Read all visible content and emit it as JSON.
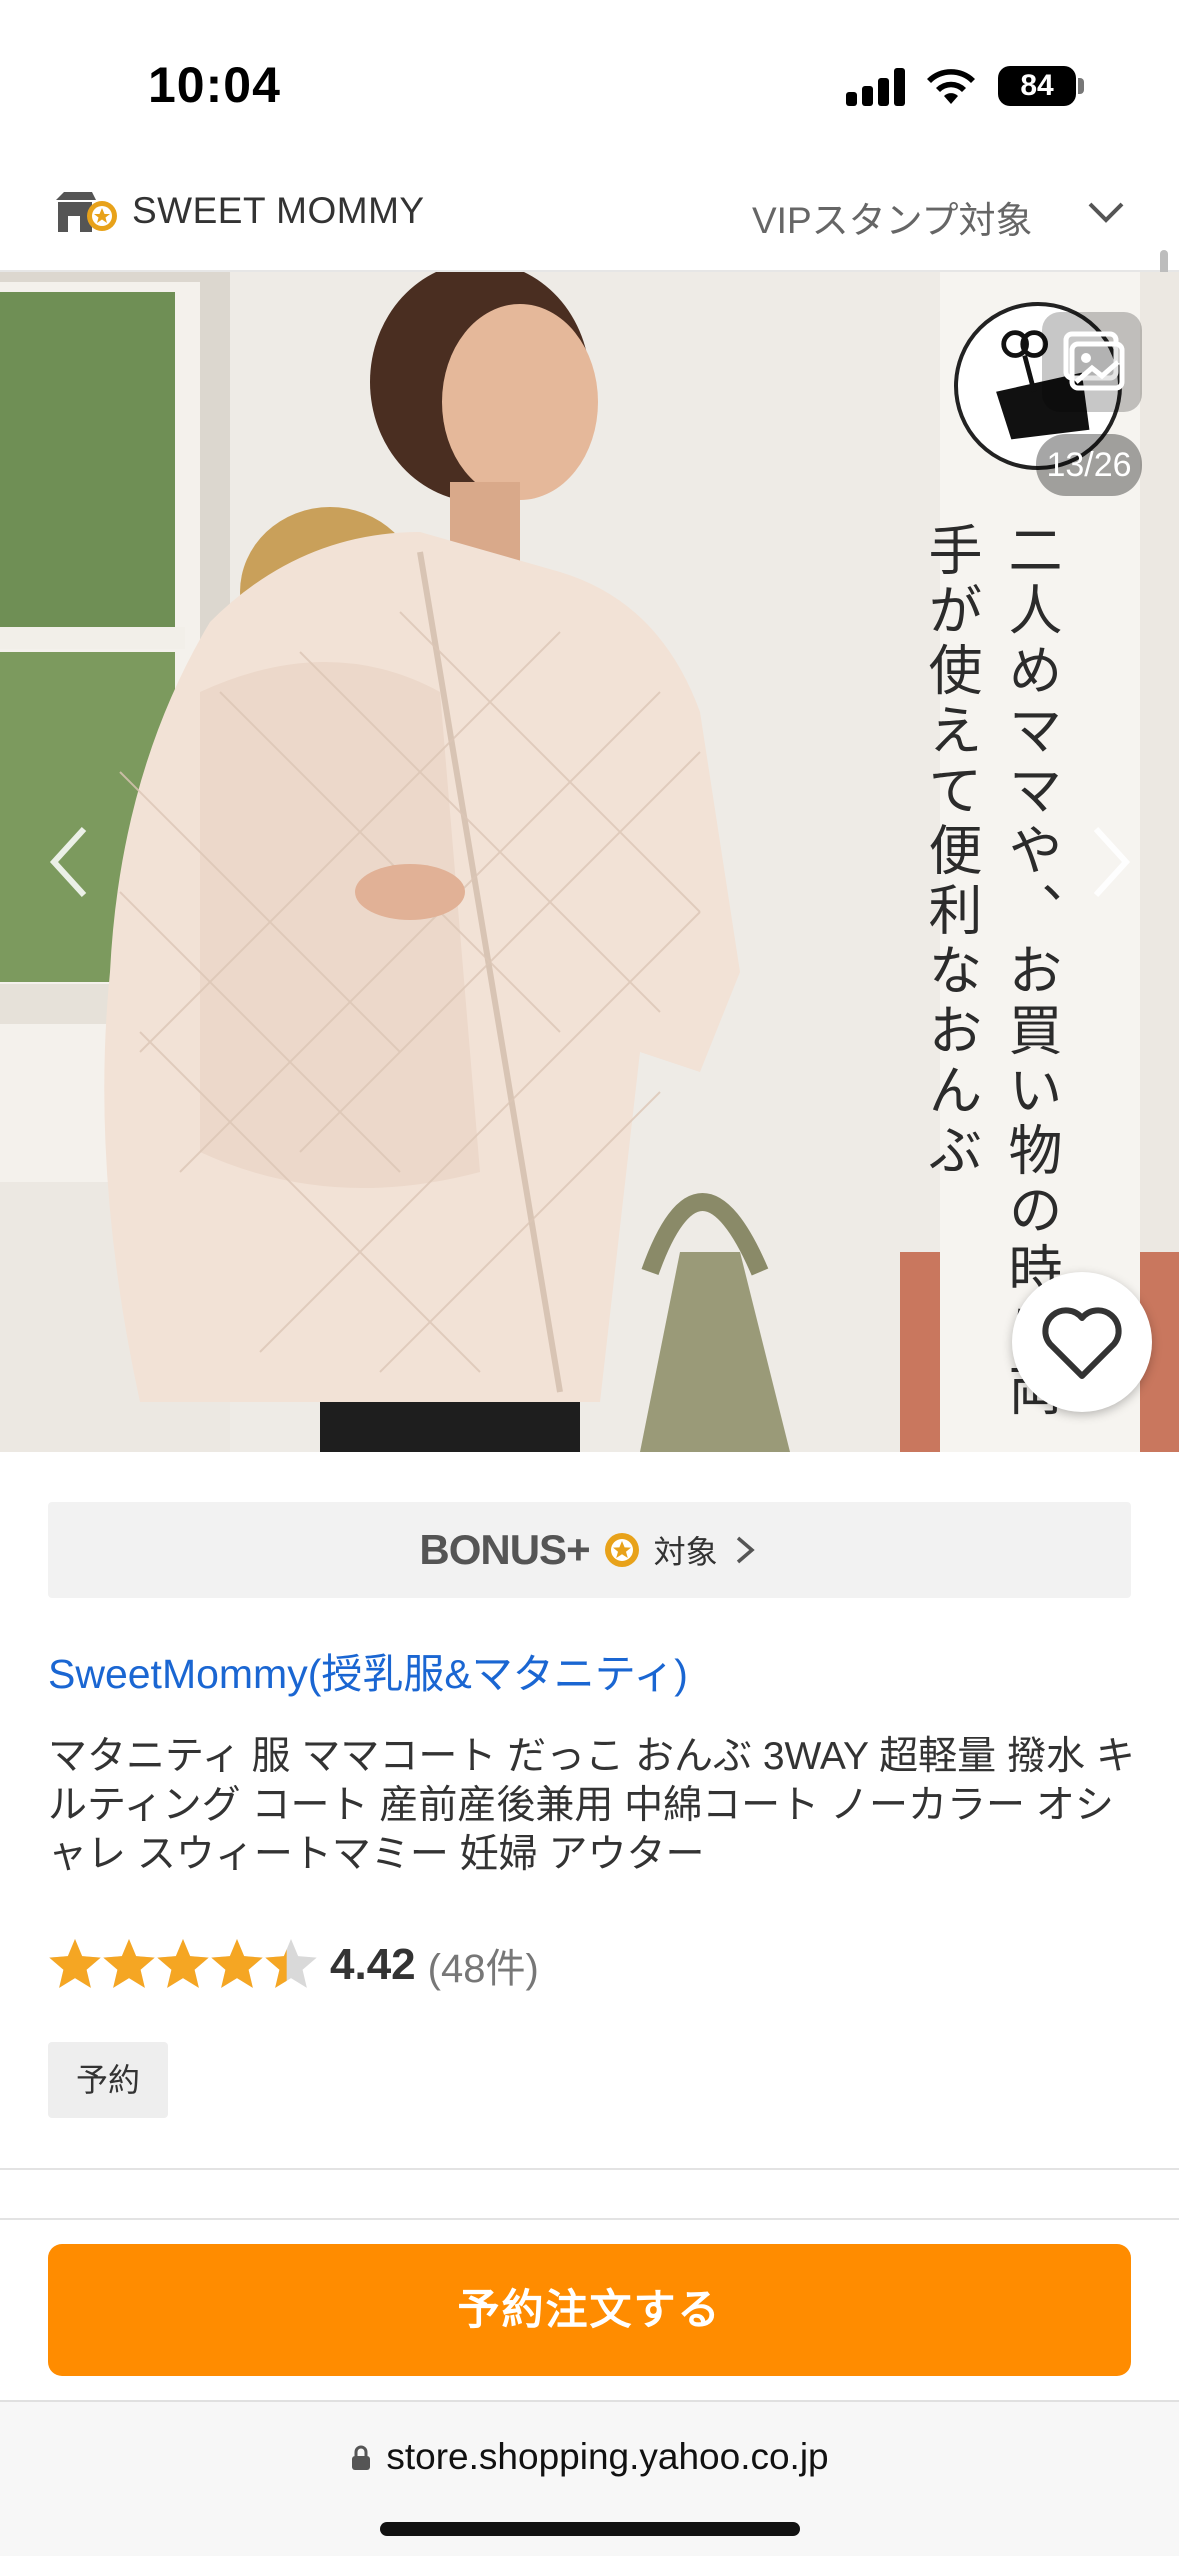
{
  "status_bar": {
    "time": "10:04",
    "battery": "84"
  },
  "store_header": {
    "store_name": "SWEET MOMMY",
    "vip_label": "VIPスタンプ対象"
  },
  "image_viewer": {
    "counter": "13/26",
    "promo_text": "二人めママや、お買い物の時に両手が使えて便利なおんぶ"
  },
  "bonus": {
    "logo": "BONUS+",
    "label": "対象"
  },
  "store_link": "SweetMommy(授乳服&マタニティ)",
  "product": {
    "title": "マタニティ 服 ママコート だっこ おんぶ 3WAY 超軽量 撥水 キルティング コート 産前産後兼用 中綿コート ノーカラー オシャレ スウィートマミー 妊婦 アウター",
    "rating_value": "4.42",
    "rating_fraction": 0.884,
    "review_count": "(48件)",
    "tag": "予約"
  },
  "order_button": "予約注文する",
  "browser": {
    "url": "store.shopping.yahoo.co.jp"
  },
  "colors": {
    "accent": "#ff8c00",
    "link": "#1a66d2",
    "star": "#f5a623"
  }
}
